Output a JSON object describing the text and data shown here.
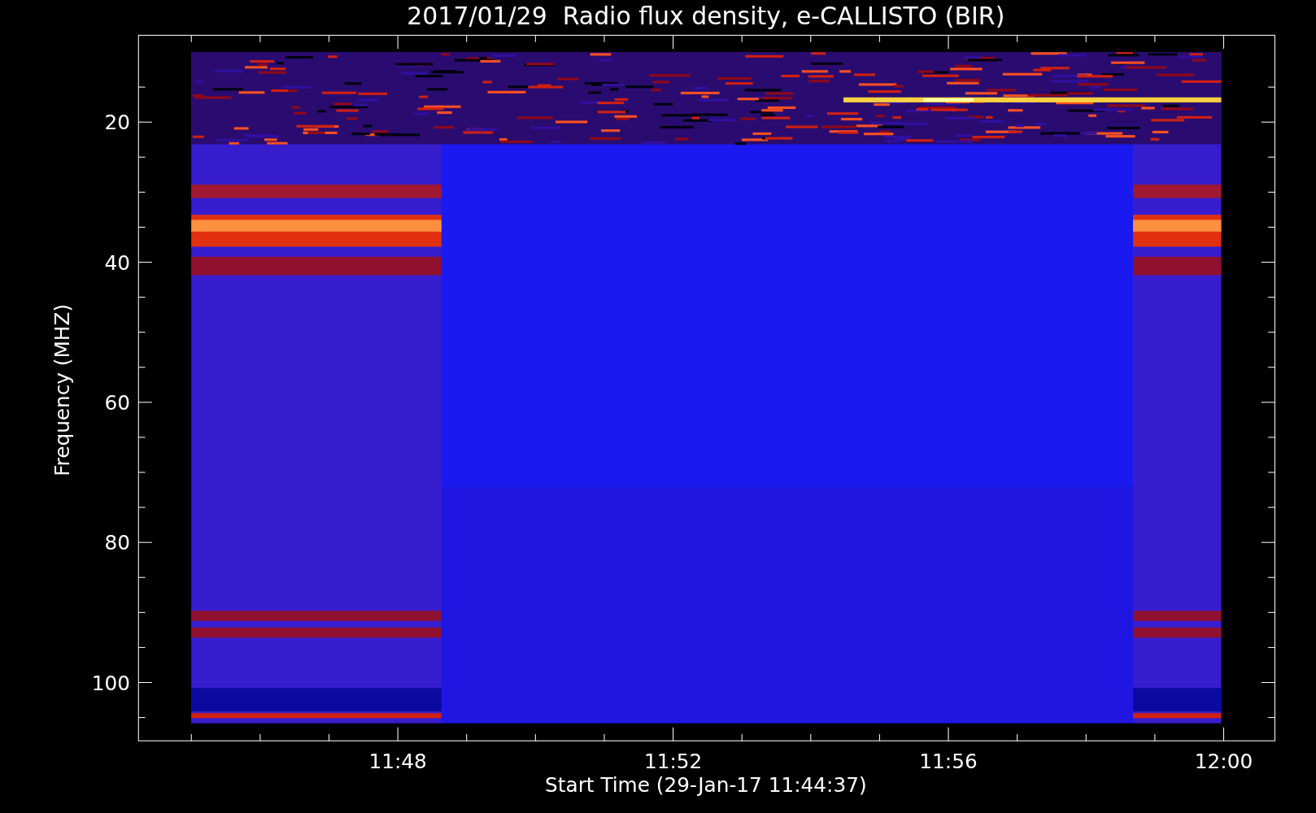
{
  "title": "2017/01/29  Radio flux density, e-CALLISTO (BIR)",
  "y_axis": {
    "label": "Frequency (MHZ)",
    "ticks": [
      "20",
      "40",
      "60",
      "80",
      "100"
    ]
  },
  "x_axis": {
    "label": "Start Time (29-Jan-17 11:44:37)",
    "ticks": [
      "11:48",
      "11:52",
      "11:56",
      "12:00"
    ]
  }
}
